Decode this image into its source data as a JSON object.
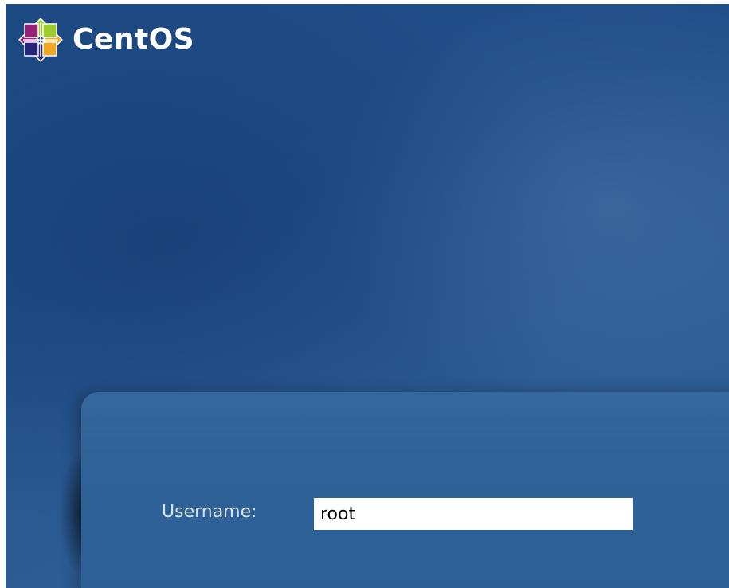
{
  "branding": {
    "logo_text": "CentOS",
    "logo_icon": "centos-logo-icon"
  },
  "login": {
    "username_label": "Username:",
    "username_value": "root"
  },
  "colors": {
    "background": "#234f88",
    "panel": "#2f6398",
    "label": "#d7e2ee",
    "input_background": "#ffffff"
  }
}
